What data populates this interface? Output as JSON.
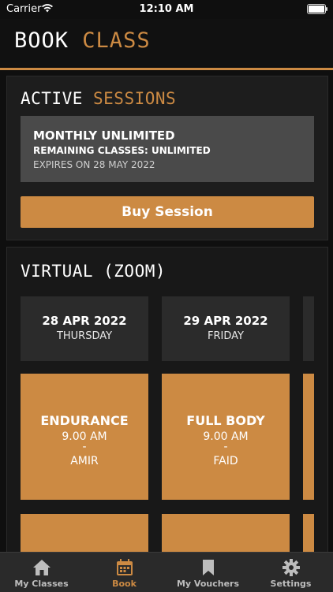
{
  "status": {
    "carrier": "Carrier",
    "time": "12:10 AM"
  },
  "header": {
    "title_white": "BOOK",
    "title_orange": "CLASS"
  },
  "active_sessions": {
    "title_white": "ACTIVE",
    "title_orange": "SESSIONS",
    "plan_name": "MONTHLY UNLIMITED",
    "remaining": "REMAINING CLASSES: UNLIMITED",
    "expiry": "EXPIRES ON 28 MAY 2022",
    "buy_label": "Buy Session"
  },
  "virtual": {
    "title": "VIRTUAL (ZOOM)",
    "days": [
      {
        "date": "28 APR 2022",
        "weekday": "THURSDAY",
        "class": {
          "name": "ENDURANCE",
          "time": "9.00 AM",
          "sep": "-",
          "instructor": "AMIR"
        }
      },
      {
        "date": "29 APR 2022",
        "weekday": "FRIDAY",
        "class": {
          "name": "FULL BODY",
          "time": "9.00 AM",
          "sep": "-",
          "instructor": "FAID"
        }
      }
    ]
  },
  "tabs": [
    {
      "label": "My Classes",
      "icon": "home-icon"
    },
    {
      "label": "Book",
      "icon": "calendar-icon"
    },
    {
      "label": "My Vouchers",
      "icon": "bookmark-icon"
    },
    {
      "label": "Settings",
      "icon": "gear-icon"
    }
  ],
  "colors": {
    "accent": "#cc8a43",
    "background": "#0f0f0f",
    "card": "#4a4a4a"
  }
}
